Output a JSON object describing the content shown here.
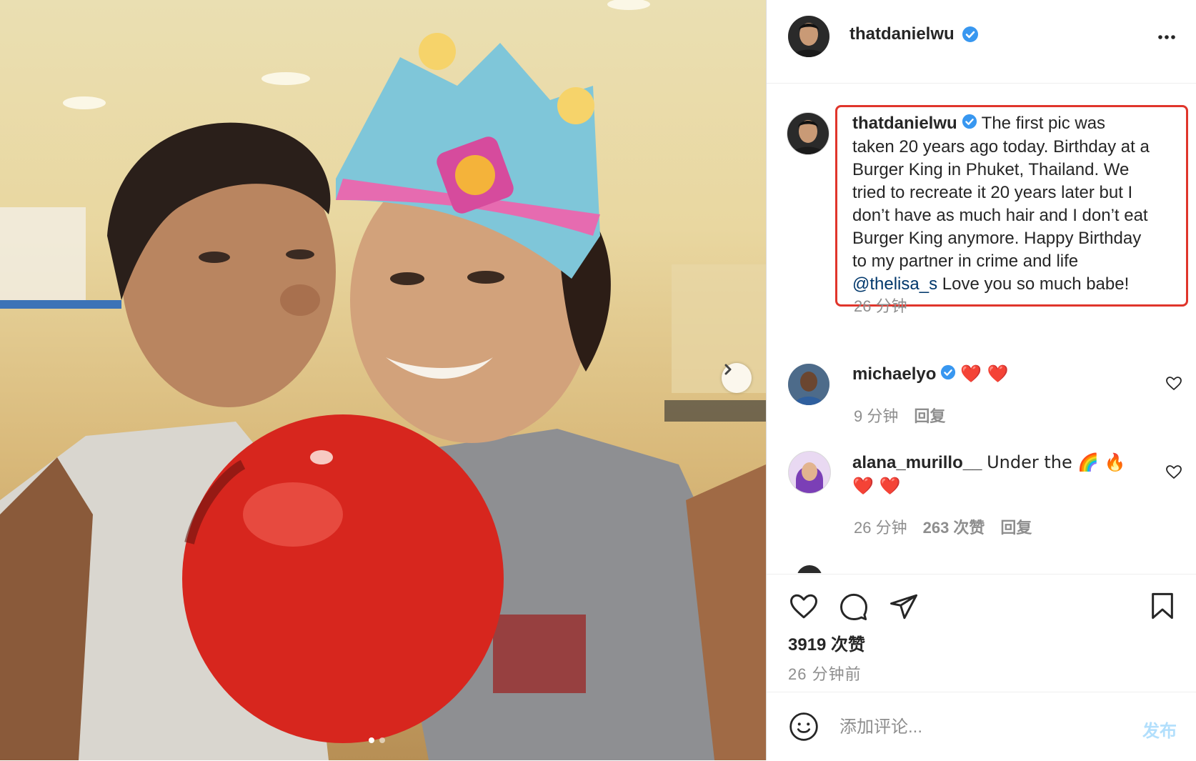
{
  "post": {
    "author": "thatdanielwu",
    "more_icon": "more-options-icon"
  },
  "photo": {
    "carousel_count": 2,
    "active_index": 0,
    "next_icon": "chevron-right-icon"
  },
  "caption": {
    "author": "thatdanielwu",
    "text_lines": [
      "The first pic was",
      "taken 20 years ago today. Birthday at a",
      "Burger King in Phuket, Thailand. We",
      "tried to recreate it 20 years later but I",
      "don’t have as much hair and I don’t eat",
      "Burger King anymore. Happy Birthday",
      "to my partner in crime and life"
    ],
    "mention": "@thelisa_s",
    "tail": " Love you so much babe!",
    "time": "26 分钟"
  },
  "comments": [
    {
      "author": "michaelyo",
      "text": "❤️ ❤️",
      "time": "9 分钟",
      "reply": "回复"
    },
    {
      "author": "alana_murillo__",
      "text_line1": "Under the 🌈 🔥",
      "text_line2": "❤️ ❤️",
      "time": "26 分钟",
      "likes": "263 次赞",
      "reply": "回复"
    }
  ],
  "actions": {
    "likes": "3919 次赞",
    "time_ago": "26 分钟前"
  },
  "add_comment": {
    "placeholder": "添加评论...",
    "post_label": "发布"
  },
  "colors": {
    "highlight_border": "#e0352b",
    "verified": "#3897f0",
    "mention": "#00376b",
    "post_disabled": "#b2dffc"
  }
}
